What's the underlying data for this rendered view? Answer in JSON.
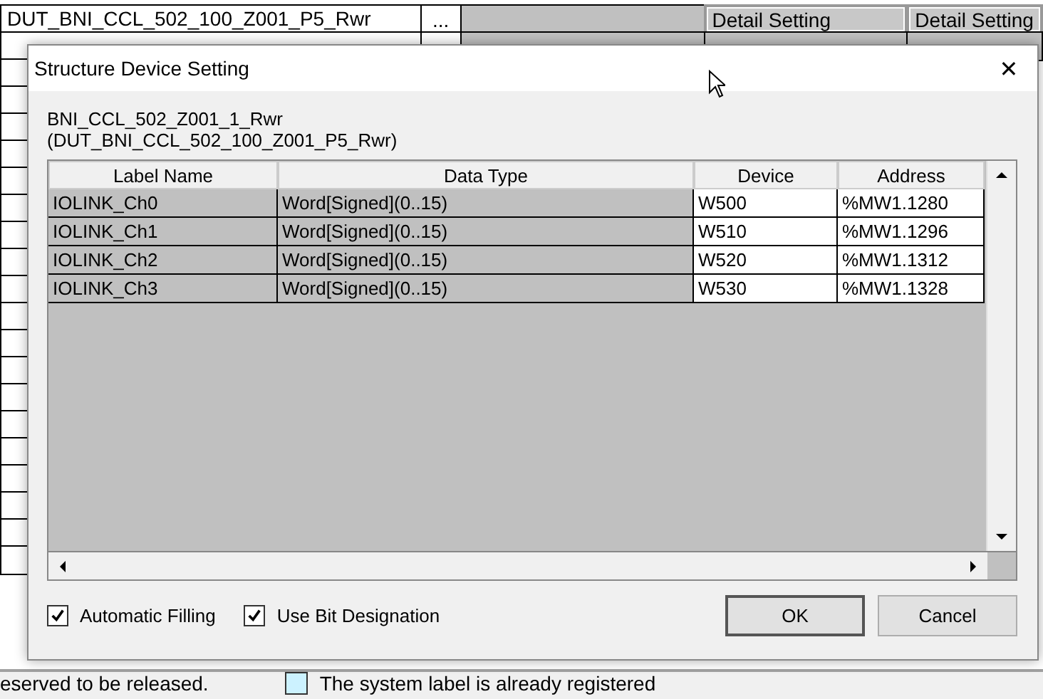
{
  "background_table": {
    "rows": [
      {
        "name": "DUT_BNI_CCL_502_100_Z001_P5_Rwr",
        "browse": "...",
        "column_4": "Detail Setting",
        "column_5": "Detail Setting"
      }
    ]
  },
  "legend": {
    "note": "eserved to be released.",
    "items": [
      {
        "label": "The system label is already registered",
        "color": "#ccf2ff"
      }
    ]
  },
  "dialog": {
    "title": "Structure Device Setting",
    "close": "✕",
    "label": "BNI_CCL_502_Z001_1_Rwr",
    "type": "(DUT_BNI_CCL_502_100_Z001_P5_Rwr)",
    "table": {
      "columns": [
        "Label Name",
        "Data Type",
        "Device",
        "Address"
      ],
      "rows": [
        {
          "cells": [
            "IOLINK_Ch0",
            "Word[Signed](0..15)",
            "W500",
            "%MW1.1280"
          ]
        },
        {
          "cells": [
            "IOLINK_Ch1",
            "Word[Signed](0..15)",
            "W510",
            "%MW1.1296"
          ]
        },
        {
          "cells": [
            "IOLINK_Ch2",
            "Word[Signed](0..15)",
            "W520",
            "%MW1.1312"
          ]
        },
        {
          "cells": [
            "IOLINK_Ch3",
            "Word[Signed](0..15)",
            "W530",
            "%MW1.1328"
          ]
        }
      ]
    },
    "options": [
      {
        "label": "Automatic Filling",
        "checked": true
      },
      {
        "label": "Use Bit Designation",
        "checked": true
      }
    ],
    "buttons": [
      "OK",
      "Cancel"
    ]
  }
}
